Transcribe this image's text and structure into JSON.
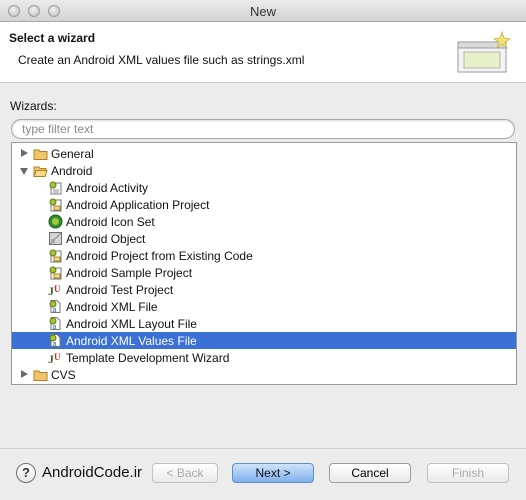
{
  "window": {
    "title": "New"
  },
  "header": {
    "title": "Select a wizard",
    "description": "Create an Android XML values file such as strings.xml"
  },
  "wizards_label": "Wizards:",
  "filter": {
    "placeholder": "type filter text",
    "value": ""
  },
  "tree": {
    "items": [
      {
        "label": "General",
        "type": "folder",
        "expanded": false
      },
      {
        "label": "Android",
        "type": "folder",
        "expanded": true
      },
      {
        "label": "Android Activity",
        "icon": "android-activity-icon"
      },
      {
        "label": "Android Application Project",
        "icon": "android-project-icon"
      },
      {
        "label": "Android Icon Set",
        "icon": "android-icon-set-icon"
      },
      {
        "label": "Android Object",
        "icon": "android-object-icon"
      },
      {
        "label": "Android Project from Existing Code",
        "icon": "android-project-icon"
      },
      {
        "label": "Android Sample Project",
        "icon": "android-project-icon"
      },
      {
        "label": "Android Test Project",
        "icon": "junit-icon"
      },
      {
        "label": "Android XML File",
        "icon": "android-xml-file-icon"
      },
      {
        "label": "Android XML Layout File",
        "icon": "android-xml-file-icon"
      },
      {
        "label": "Android XML Values File",
        "icon": "android-xml-file-icon",
        "selected": true
      },
      {
        "label": "Template Development Wizard",
        "icon": "junit-icon"
      },
      {
        "label": "CVS",
        "type": "folder",
        "expanded": false
      }
    ]
  },
  "footer": {
    "brand": "AndroidCode.ir",
    "back_label": "< Back",
    "next_label": "Next >",
    "cancel_label": "Cancel",
    "finish_label": "Finish"
  },
  "colors": {
    "selection": "#3b70d4",
    "header_bg": "#ffffff",
    "dialog_bg": "#ececec"
  }
}
